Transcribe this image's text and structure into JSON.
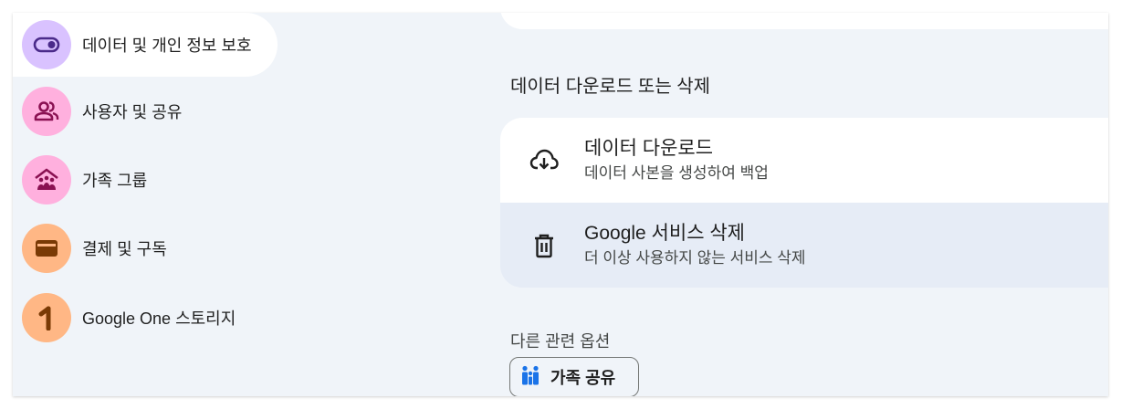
{
  "sidebar": {
    "items": [
      {
        "label": "데이터 및 개인 정보 보호",
        "icon": "toggle-icon",
        "color": "#d9c2ff",
        "active": true
      },
      {
        "label": "사용자 및 공유",
        "icon": "people-icon",
        "color": "#ffb0de"
      },
      {
        "label": "가족 그룹",
        "icon": "family-home-icon",
        "color": "#ffb0de"
      },
      {
        "label": "결제 및 구독",
        "icon": "wallet-icon",
        "color": "#ffb785"
      },
      {
        "label": "Google One 스토리지",
        "icon": "google-one-icon",
        "color": "#ffb785"
      }
    ]
  },
  "main": {
    "section_title": "데이터 다운로드 또는 삭제",
    "cards": [
      {
        "title": "데이터 다운로드",
        "subtitle": "데이터 사본을 생성하여 백업",
        "icon": "cloud-download-icon"
      },
      {
        "title": "Google 서비스 삭제",
        "subtitle": "더 이상 사용하지 않는 서비스 삭제",
        "icon": "trash-icon"
      }
    ],
    "related": {
      "title": "다른 관련 옵션",
      "chip_label": "가족 공유",
      "chip_icon": "family-icon"
    }
  },
  "colors": {
    "background": "#f0f4f9",
    "card": "#ffffff",
    "card_hover": "#e6ecf6",
    "accent_blue": "#1a73e8"
  }
}
